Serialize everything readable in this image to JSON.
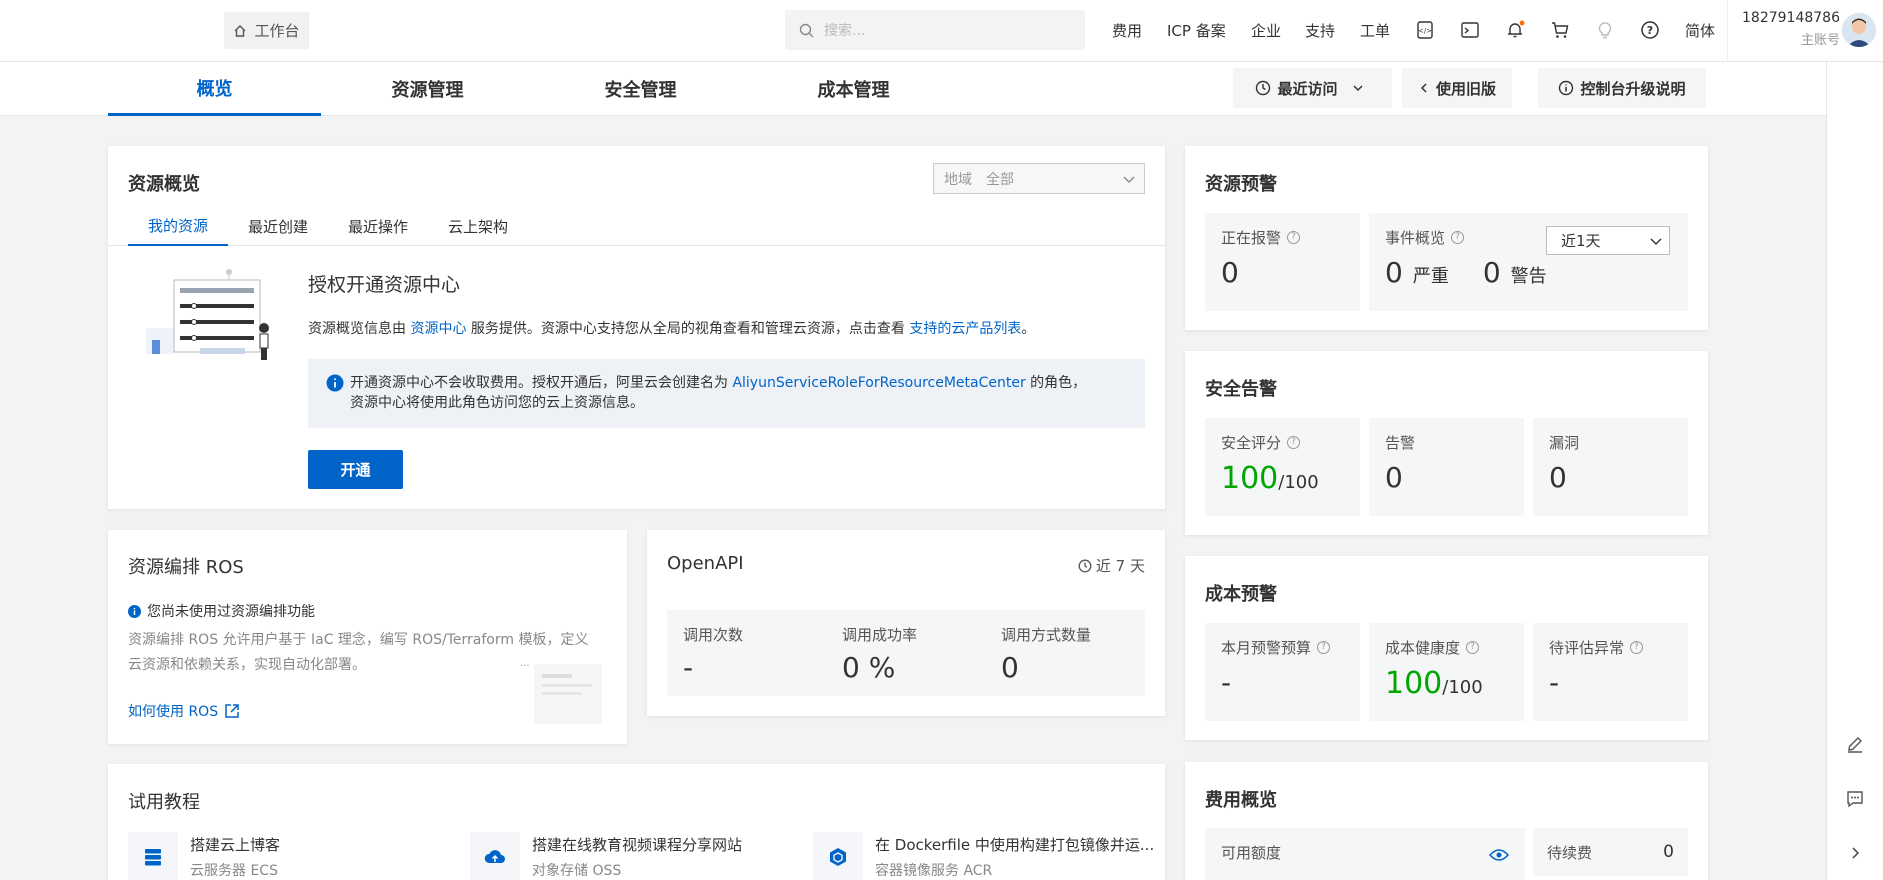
{
  "topbar": {
    "workbench": "工作台",
    "search_placeholder": "搜索...",
    "links": [
      "费用",
      "ICP 备案",
      "企业",
      "支持",
      "工单"
    ],
    "language": "简体",
    "account_id": "18279148786",
    "account_type": "主账号"
  },
  "tabs": [
    {
      "label": "概览",
      "active": true
    },
    {
      "label": "资源管理"
    },
    {
      "label": "安全管理"
    },
    {
      "label": "成本管理"
    }
  ],
  "toolbar": {
    "recent": "最近访问",
    "old_version": "使用旧版",
    "upgrade_info": "控制台升级说明"
  },
  "resource_overview": {
    "title": "资源概览",
    "region_label": "地域",
    "region_value": "全部",
    "subtabs": [
      "我的资源",
      "最近创建",
      "最近操作",
      "云上架构"
    ],
    "heading": "授权开通资源中心",
    "desc_prefix": "资源概览信息由",
    "desc_link1": "资源中心",
    "desc_middle": "服务提供。资源中心支持您从全局的视角查看和管理云资源，点击查看",
    "desc_link2": "支持的云产品列表",
    "desc_suffix": "。",
    "notice_prefix": "开通资源中心不会收取费用。授权开通后，阿里云会创建名为",
    "notice_link": "AliyunServiceRoleForResourceMetaCenter",
    "notice_suffix": "的角色，",
    "notice_line2": "资源中心将使用此角色访问您的云上资源信息。",
    "button": "开通"
  },
  "ros": {
    "title": "资源编排 ROS",
    "notice": "您尚未使用过资源编排功能",
    "desc_line1": "资源编排 ROS 允许用户基于 IaC 理念，编写 ROS/Terraform 模板，定义",
    "desc_line2": "云资源和依赖关系，实现自动化部署。",
    "link": "如何使用 ROS"
  },
  "openapi": {
    "title": "OpenAPI",
    "period": "近 7 天",
    "stats": [
      {
        "label": "调用次数",
        "value": "-"
      },
      {
        "label": "调用成功率",
        "value": "0 %"
      },
      {
        "label": "调用方式数量",
        "value": "0"
      }
    ]
  },
  "tutorials": {
    "title": "试用教程",
    "items": [
      {
        "title": "搭建云上博客",
        "sub": "云服务器 ECS"
      },
      {
        "title": "搭建在线教育视频课程分享网站",
        "sub": "对象存储 OSS"
      },
      {
        "title": "在 Dockerfile 中使用构建打包镜像并运...",
        "sub": "容器镜像服务 ACR"
      }
    ]
  },
  "resource_alert": {
    "title": "资源预警",
    "alarming_label": "正在报警",
    "alarming_value": "0",
    "events_label": "事件概览",
    "period": "近1天",
    "severe_value": "0",
    "severe_label": "严重",
    "warning_value": "0",
    "warning_label": "警告"
  },
  "security": {
    "title": "安全告警",
    "score_label": "安全评分",
    "score_value": "100",
    "score_total": "/100",
    "alert_label": "告警",
    "alert_value": "0",
    "vuln_label": "漏洞",
    "vuln_value": "0"
  },
  "cost_alert": {
    "title": "成本预警",
    "budget_label": "本月预警预算",
    "budget_value": "-",
    "health_label": "成本健康度",
    "health_value": "100",
    "health_total": "/100",
    "anomaly_label": "待评估异常",
    "anomaly_value": "-"
  },
  "fees": {
    "title": "费用概览",
    "available_label": "可用额度",
    "pending_label": "待续费",
    "pending_value": "0"
  },
  "colors": {
    "accent": "#0064c8",
    "green": "#00a700"
  }
}
